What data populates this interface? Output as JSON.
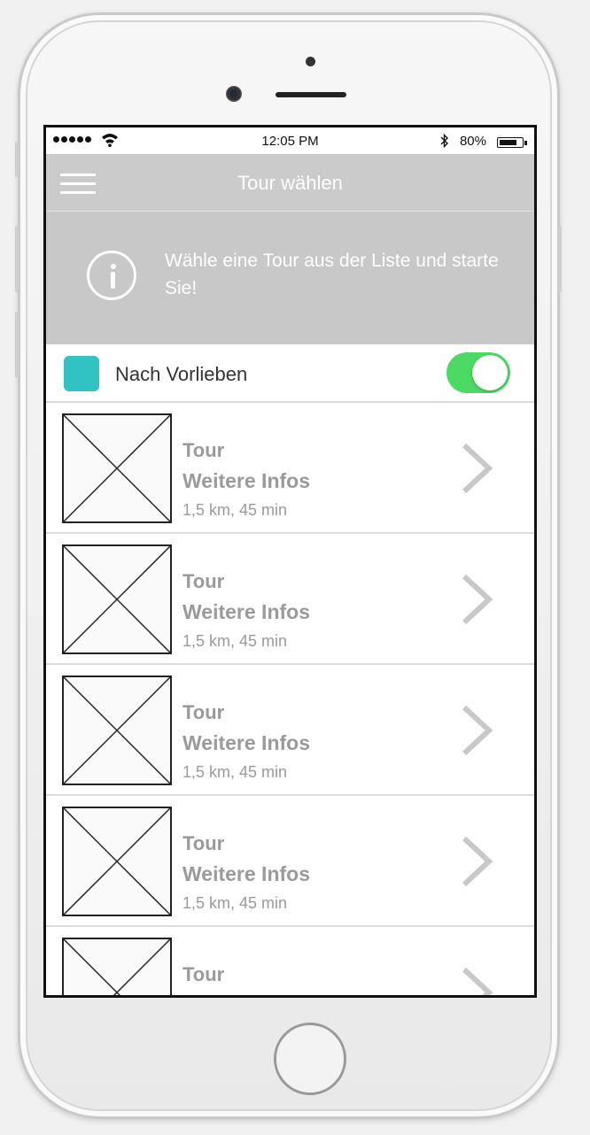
{
  "status_bar": {
    "time": "12:05 PM",
    "battery_percent": "80%",
    "battery_level": 0.8,
    "icons": [
      "signal-dots-icon",
      "wifi-icon",
      "bluetooth-icon",
      "battery-icon"
    ]
  },
  "nav": {
    "title": "Tour wählen",
    "menu_icon": "hamburger-menu-icon"
  },
  "info": {
    "icon": "info-circle-icon",
    "text": "Wähle eine Tour aus der Liste und starte Sie!"
  },
  "preference": {
    "label": "Nach Vorlieben",
    "swatch_color": "#31c2c4",
    "toggle_on": true,
    "toggle_color": "#4cd964"
  },
  "tours": [
    {
      "title": "Tour",
      "subtitle": "Weitere Infos",
      "meta": "1,5 km, 45 min"
    },
    {
      "title": "Tour",
      "subtitle": "Weitere Infos",
      "meta": "1,5 km, 45 min"
    },
    {
      "title": "Tour",
      "subtitle": "Weitere Infos",
      "meta": "1,5 km, 45 min"
    },
    {
      "title": "Tour",
      "subtitle": "Weitere Infos",
      "meta": "1,5 km, 45 min"
    },
    {
      "title": "Tour",
      "subtitle": "",
      "meta": ""
    }
  ]
}
